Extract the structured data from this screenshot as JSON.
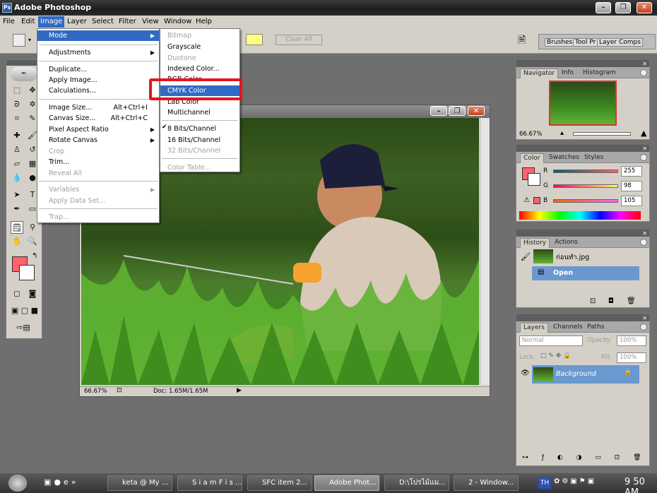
{
  "app": {
    "title": "Adobe Photoshop"
  },
  "menubar": [
    "File",
    "Edit",
    "Image",
    "Layer",
    "Select",
    "Filter",
    "View",
    "Window",
    "Help"
  ],
  "options": {
    "clear_all": "Clear All",
    "panel_tabs": [
      "Brushes",
      "Tool Pr",
      "Layer Comps"
    ]
  },
  "image_menu": {
    "mode": "Mode",
    "adjustments": "Adjustments",
    "duplicate": "Duplicate...",
    "apply_image": "Apply Image...",
    "calculations": "Calculations...",
    "image_size": "Image Size...",
    "image_size_sc": "Alt+Ctrl+I",
    "canvas_size": "Canvas Size...",
    "canvas_size_sc": "Alt+Ctrl+C",
    "pixel_aspect": "Pixel Aspect Ratio",
    "rotate_canvas": "Rotate Canvas",
    "crop": "Crop",
    "trim": "Trim...",
    "reveal_all": "Reveal All",
    "variables": "Variables",
    "apply_data_set": "Apply Data Set...",
    "trap": "Trap..."
  },
  "mode_menu": {
    "bitmap": "Bitmap",
    "grayscale": "Grayscale",
    "duotone": "Duotone",
    "indexed": "Indexed Color...",
    "rgb": "RGB Color",
    "cmyk": "CMYK Color",
    "lab": "Lab Color",
    "multichannel": "Multichannel",
    "bits8": "8 Bits/Channel",
    "bits16": "16 Bits/Channel",
    "bits32": "32 Bits/Channel",
    "color_table": "Color Table..."
  },
  "document": {
    "zoom": "66.67%",
    "doc_size": "Doc: 1.65M/1.65M"
  },
  "navigator": {
    "tabs": [
      "Navigator",
      "Info",
      "Histogram"
    ],
    "zoom": "66.67%"
  },
  "color": {
    "tabs": [
      "Color",
      "Swatches",
      "Styles"
    ],
    "r_label": "R",
    "g_label": "G",
    "b_label": "B",
    "r": "255",
    "g": "98",
    "b": "105",
    "fg": "#ff6269"
  },
  "history": {
    "tabs": [
      "History",
      "Actions"
    ],
    "snapshot": "ก่อนทำ.jpg",
    "step": "Open"
  },
  "layers": {
    "tabs": [
      "Layers",
      "Channels",
      "Paths"
    ],
    "blend": "Normal",
    "opacity_label": "Opacity:",
    "opacity": "100%",
    "lock_label": "Lock:",
    "fill_label": "Fill:",
    "fill": "100%",
    "layer": "Background"
  },
  "taskbar": {
    "items": [
      "keta @ My ...",
      "S i a m F i s ...",
      "SFC item 2...",
      "Adobe Phot...",
      "D:\\โปรไม้แม...",
      "2 - Window..."
    ],
    "time": "9 50 AM",
    "lang": "TH"
  }
}
